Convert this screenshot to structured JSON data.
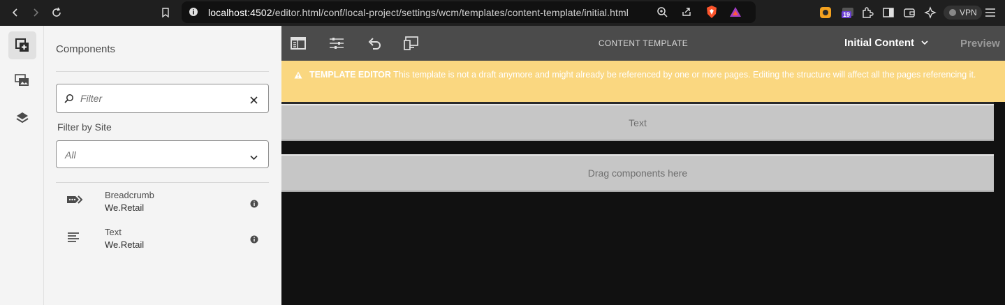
{
  "browser": {
    "url_host": "localhost:4502",
    "url_path": "/editor.html/conf/local-project/settings/wcm/templates/content-template/initial.html",
    "badge_count": "19",
    "vpn_label": "VPN"
  },
  "sidebar": {
    "title": "Components",
    "filter_placeholder": "Filter",
    "filter_by_site_label": "Filter by Site",
    "site_select_value": "All",
    "components": [
      {
        "name": "Breadcrumb",
        "group": "We.Retail",
        "icon": "breadcrumb-icon"
      },
      {
        "name": "Text",
        "group": "We.Retail",
        "icon": "text-align-icon"
      }
    ]
  },
  "toolbar": {
    "title": "CONTENT TEMPLATE",
    "mode_label": "Initial Content",
    "preview_label": "Preview"
  },
  "alert": {
    "heading": "TEMPLATE EDITOR",
    "message": "This template is not a draft anymore and might already be referenced by one or more pages. Editing the structure will affect all the pages referencing it."
  },
  "canvas": {
    "text_component_label": "Text",
    "dropzone_label": "Drag components here"
  },
  "colors": {
    "alert_bg": "#fad780",
    "toolbar_bg": "#4b4b4b",
    "panel_bg": "#f4f4f4",
    "editor_bg": "#111111"
  }
}
